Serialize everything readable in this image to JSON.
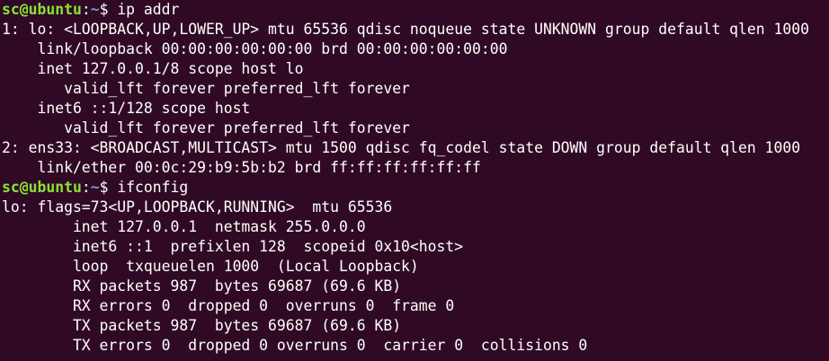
{
  "colors": {
    "background": "#300a24",
    "text": "#ffffff",
    "prompt_user": "#8ae234",
    "prompt_path": "#729fcf"
  },
  "prompts": [
    {
      "user": "sc@ubuntu",
      "colon": ":",
      "path": "~",
      "symbol": "$ ",
      "command": "ip addr"
    },
    {
      "user": "sc@ubuntu",
      "colon": ":",
      "path": "~",
      "symbol": "$ ",
      "command": "ifconfig"
    }
  ],
  "ip_addr_output": [
    "1: lo: <LOOPBACK,UP,LOWER_UP> mtu 65536 qdisc noqueue state UNKNOWN group default qlen 1000",
    "    link/loopback 00:00:00:00:00:00 brd 00:00:00:00:00:00",
    "    inet 127.0.0.1/8 scope host lo",
    "       valid_lft forever preferred_lft forever",
    "    inet6 ::1/128 scope host",
    "       valid_lft forever preferred_lft forever",
    "2: ens33: <BROADCAST,MULTICAST> mtu 1500 qdisc fq_codel state DOWN group default qlen 1000",
    "    link/ether 00:0c:29:b9:5b:b2 brd ff:ff:ff:ff:ff:ff"
  ],
  "ifconfig_output": [
    "lo: flags=73<UP,LOOPBACK,RUNNING>  mtu 65536",
    "        inet 127.0.0.1  netmask 255.0.0.0",
    "        inet6 ::1  prefixlen 128  scopeid 0x10<host>",
    "        loop  txqueuelen 1000  (Local Loopback)",
    "        RX packets 987  bytes 69687 (69.6 KB)",
    "        RX errors 0  dropped 0  overruns 0  frame 0",
    "        TX packets 987  bytes 69687 (69.6 KB)",
    "        TX errors 0  dropped 0 overruns 0  carrier 0  collisions 0"
  ]
}
